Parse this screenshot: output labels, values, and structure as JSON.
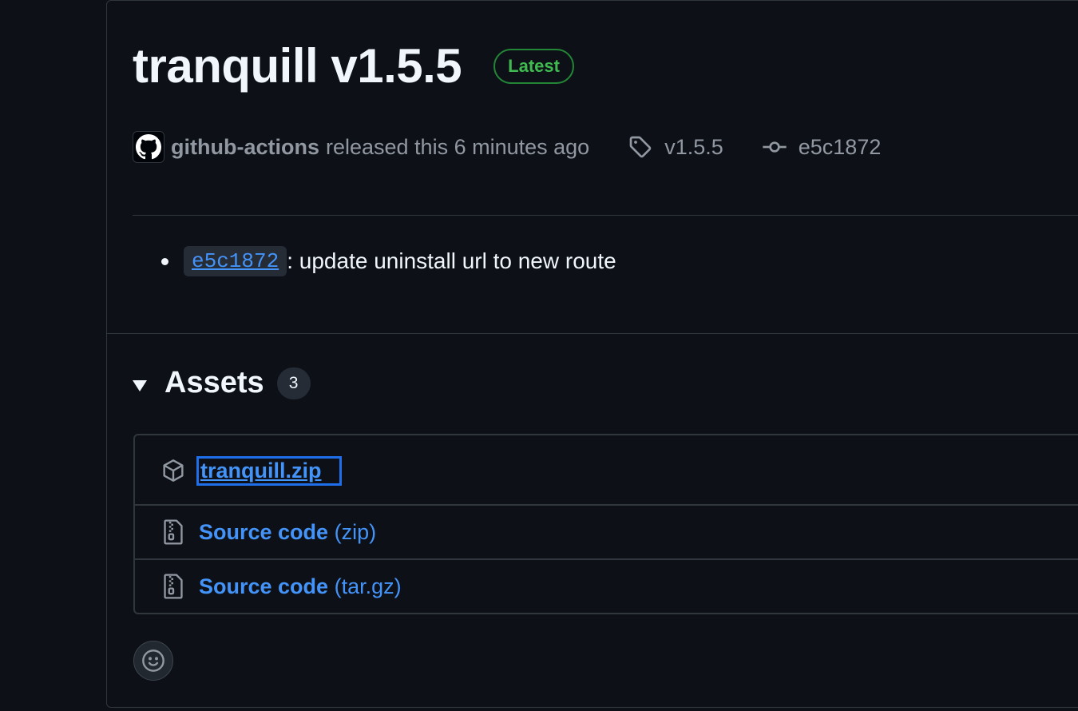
{
  "release": {
    "title": "tranquill v1.5.5",
    "badge": "Latest",
    "author": "github-actions",
    "released_text": "released this 6 minutes ago",
    "tag": "v1.5.5",
    "commit": "e5c1872"
  },
  "notes": {
    "items": [
      {
        "commit": "e5c1872",
        "text": ": update uninstall url to new route"
      }
    ]
  },
  "assets": {
    "title": "Assets",
    "count": "3",
    "items": [
      {
        "name": "tranquill.zip",
        "ext": "",
        "icon": "package-icon"
      },
      {
        "name": "Source code",
        "ext": "(zip)",
        "icon": "file-zip-icon"
      },
      {
        "name": "Source code",
        "ext": "(tar.gz)",
        "icon": "file-zip-icon"
      }
    ]
  },
  "colors": {
    "background": "#0d1117",
    "border": "#30363d",
    "link": "#4493f8",
    "latest": "#3fb950",
    "muted": "#9198a1"
  }
}
